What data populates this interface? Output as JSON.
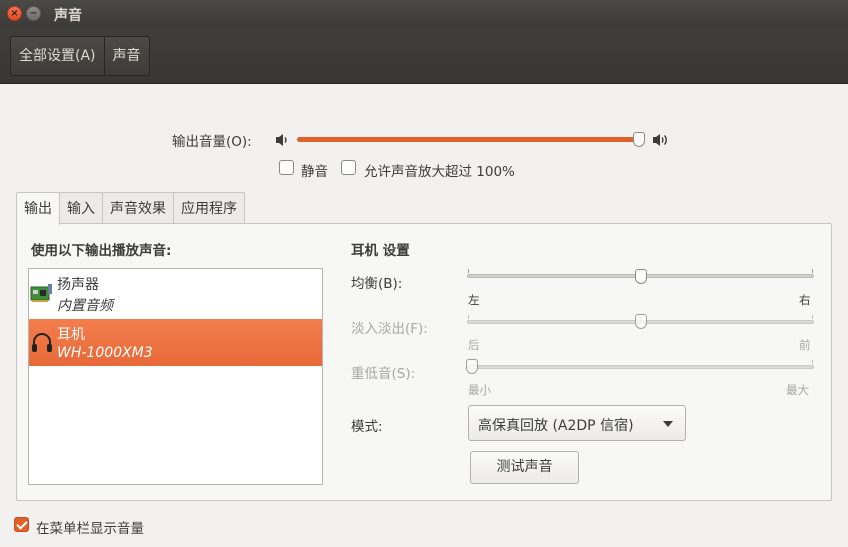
{
  "window": {
    "title": "声音"
  },
  "toolbar": {
    "all_settings": "全部设置(A)",
    "current": "声音"
  },
  "output_volume": {
    "label": "输出音量(O):",
    "level": 0.99,
    "mute_label": "静音",
    "mute_checked": false,
    "amplify_label": "允许声音放大超过 100%",
    "amplify_checked": false
  },
  "tabs": [
    "输出",
    "输入",
    "声音效果",
    "应用程序"
  ],
  "active_tab": "输出",
  "output": {
    "device_list_title": "使用以下输出播放声音:",
    "devices": [
      {
        "name": "扬声器",
        "description": "内置音频",
        "icon": "sound-card-icon",
        "selected": false
      },
      {
        "name": "耳机",
        "description": "WH-1000XM3",
        "icon": "headphones-icon",
        "selected": true
      }
    ],
    "settings_title": "耳机 设置",
    "balance": {
      "label": "均衡(B):",
      "left": "左",
      "right": "右",
      "value": 0.5,
      "enabled": true
    },
    "fade": {
      "label": "淡入淡出(F):",
      "left": "后",
      "right": "前",
      "value": 0.5,
      "enabled": false
    },
    "subwoofer": {
      "label": "重低音(S):",
      "left": "最小",
      "right": "最大",
      "value": 0.0,
      "enabled": false
    },
    "mode": {
      "label": "模式:",
      "value": "高保真回放 (A2DP 信宿)"
    },
    "test_button": "测试声音"
  },
  "footer": {
    "show_in_menubar_label": "在菜单栏显示音量",
    "show_in_menubar_checked": true
  },
  "colors": {
    "accent": "#e0622b",
    "selection": "#f07746",
    "titlebar": "#3c3b37"
  }
}
